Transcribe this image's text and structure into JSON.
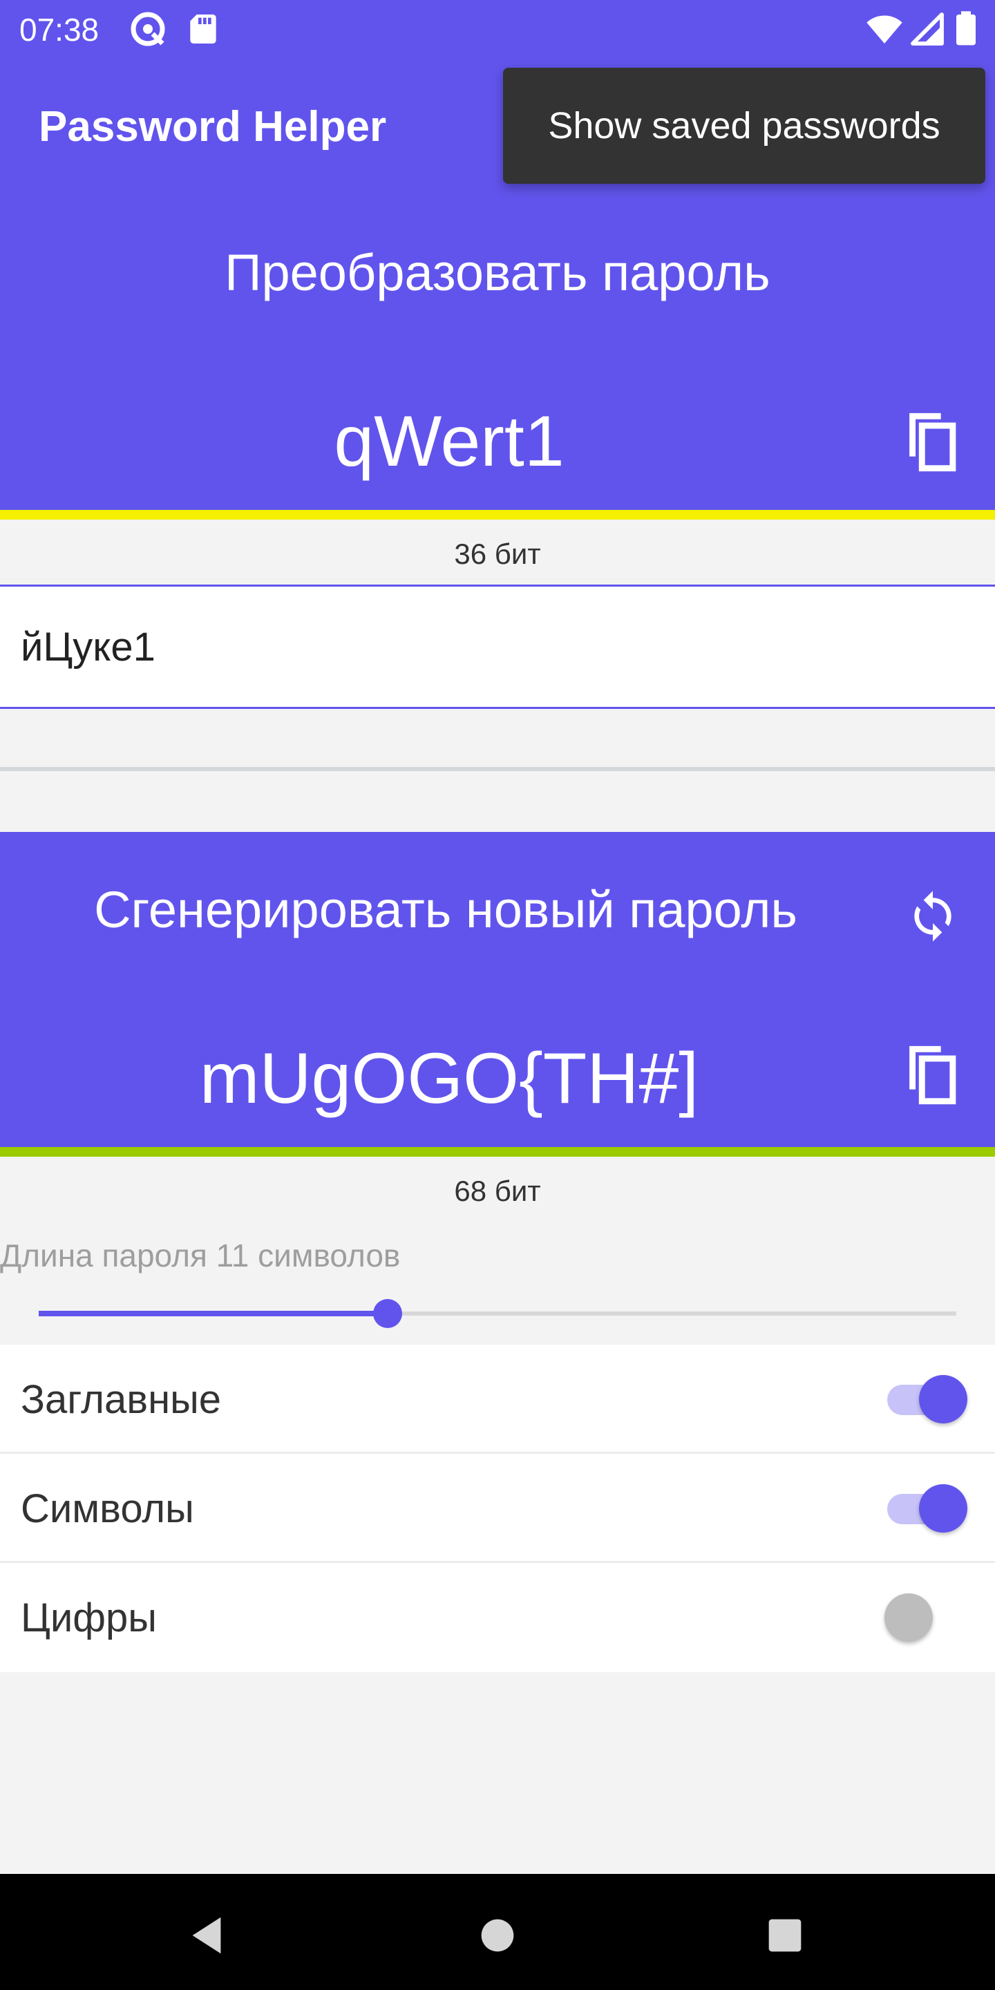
{
  "status_bar": {
    "time": "07:38",
    "icons": [
      "at-sign-icon",
      "sd-card-icon",
      "wifi-icon",
      "signal-icon",
      "battery-icon"
    ]
  },
  "app_bar": {
    "title": "Password Helper",
    "toast": "Show saved passwords"
  },
  "convert_section": {
    "title": "Преобразовать пароль",
    "password": "qWert1",
    "strength_color": "#f4f000",
    "bits": "36 бит",
    "input_value": "йЦуке1"
  },
  "generate_section": {
    "title": "Сгенерировать новый пароль",
    "password": "mUgOGO{TH#]",
    "strength_color": "#9ccc00",
    "bits": "68 бит",
    "length_label": "Длина пароля 11 символов",
    "slider_fraction": 0.38
  },
  "options": [
    {
      "label": "Заглавные",
      "enabled": true
    },
    {
      "label": "Символы",
      "enabled": true
    },
    {
      "label": "Цифры",
      "enabled": false
    }
  ],
  "nav_bar": {
    "icons": [
      "back-icon",
      "home-icon",
      "recents-icon"
    ]
  },
  "colors": {
    "primary": "#6154ed",
    "background": "#f3f3f3"
  }
}
